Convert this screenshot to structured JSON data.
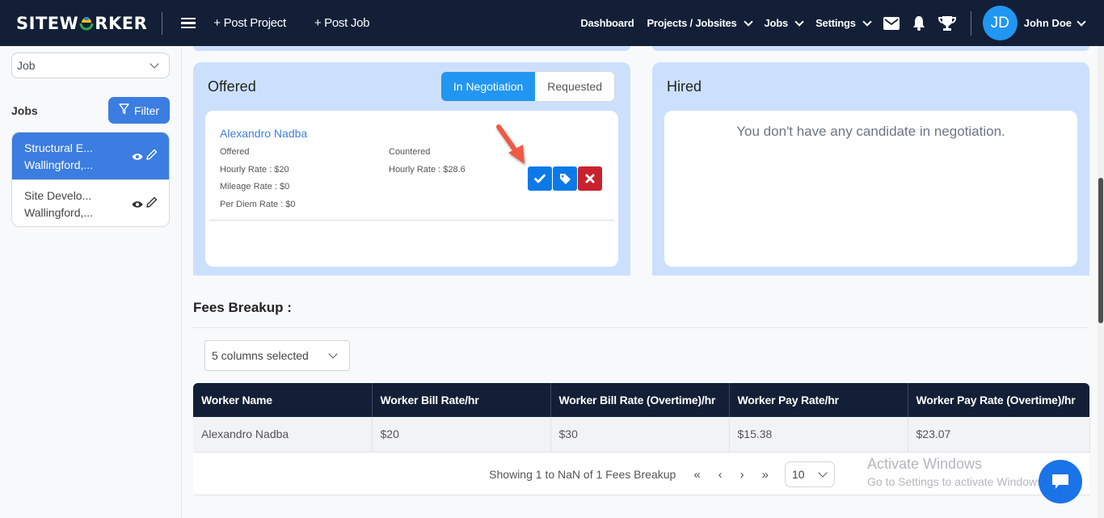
{
  "navbar": {
    "logo_prefix": "SITEW",
    "logo_suffix": "RKER",
    "post_project": "+ Post Project",
    "post_job": "+ Post Job",
    "dashboard": "Dashboard",
    "projects": "Projects / Jobsites",
    "jobs": "Jobs",
    "settings": "Settings",
    "avatar_initials": "JD",
    "user_name": "John Doe"
  },
  "sidebar": {
    "select_value": "Job",
    "jobs_label": "Jobs",
    "filter_label": "Filter",
    "jobs": [
      {
        "title": "Structural E...",
        "location": "Wallingford,...",
        "active": true
      },
      {
        "title": "Site Develo...",
        "location": "Wallingford,...",
        "active": false
      }
    ]
  },
  "offered": {
    "title": "Offered",
    "tabs": [
      "In Negotiation",
      "Requested"
    ],
    "active_tab": "In Negotiation",
    "candidate": {
      "name": "Alexandro Nadba",
      "offered_label": "Offered",
      "offered_hourly": "Hourly Rate : $20",
      "offered_mileage": "Mileage Rate : $0",
      "offered_per_diem": "Per Diem Rate : $0",
      "countered_label": "Countered",
      "countered_hourly": "Hourly Rate : $28.6"
    },
    "actions": [
      "accept",
      "tag",
      "reject"
    ]
  },
  "hired": {
    "title": "Hired",
    "empty_message": "You don't have any candidate in negotiation."
  },
  "fees": {
    "title": "Fees Breakup :",
    "columns_select": "5 columns selected",
    "headers": [
      "Worker Name",
      "Worker Bill Rate/hr",
      "Worker Bill Rate (Overtime)/hr",
      "Worker Pay Rate/hr",
      "Worker Pay Rate (Overtime)/hr"
    ],
    "rows": [
      [
        "Alexandro Nadba",
        "$20",
        "$30",
        "$15.38",
        "$23.07"
      ]
    ],
    "pagination": {
      "summary": "Showing 1 to NaN of 1 Fees Breakup",
      "first": "«",
      "prev": "‹",
      "next": "›",
      "last": "»",
      "per_page": "10"
    }
  },
  "watermark": {
    "line1": "Activate Windows",
    "line2": "Go to Settings to activate Windows."
  },
  "colors": {
    "navbar": "#131f37",
    "accent": "#3b7de0",
    "panel": "#cce0fd",
    "danger": "#c8222f"
  }
}
